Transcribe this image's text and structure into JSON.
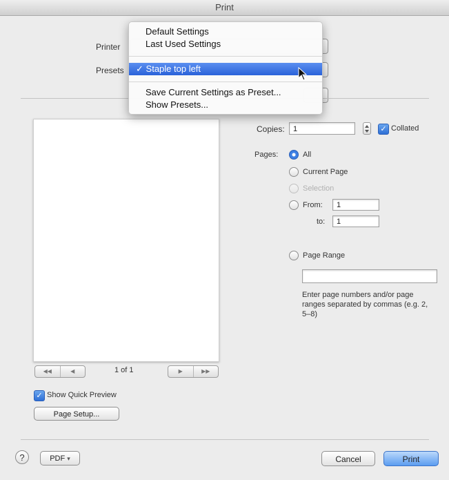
{
  "window": {
    "title": "Print"
  },
  "header": {
    "printer_label": "Printer",
    "presets_label": "Presets",
    "presets_menu": {
      "items": [
        {
          "label": "Default Settings"
        },
        {
          "label": "Last Used Settings"
        },
        {
          "label": "Staple top left",
          "checked": true
        },
        {
          "label": "Save Current Settings as Preset..."
        },
        {
          "label": "Show Presets..."
        }
      ],
      "checkmark": "✓"
    }
  },
  "preview": {
    "page_indicator": "1 of 1",
    "nav_first": "◀◀",
    "nav_prev": "◀",
    "nav_next": "▶",
    "nav_last": "▶▶",
    "show_quick_preview": "Show Quick Preview",
    "page_setup": "Page Setup..."
  },
  "options": {
    "copies_label": "Copies:",
    "copies_value": "1",
    "collated_label": "Collated",
    "pages_label": "Pages:",
    "radio_all": "All",
    "radio_current_page": "Current Page",
    "radio_selection": "Selection",
    "radio_from": "From:",
    "from_value": "1",
    "to_label": "to:",
    "to_value": "1",
    "radio_page_range": "Page Range",
    "page_range_value": "",
    "hint": "Enter page numbers and/or page ranges separated by commas (e.g. 2, 5–8)"
  },
  "footer": {
    "help": "?",
    "pdf": "PDF",
    "pdf_arrow": "▾",
    "cancel": "Cancel",
    "print": "Print"
  }
}
